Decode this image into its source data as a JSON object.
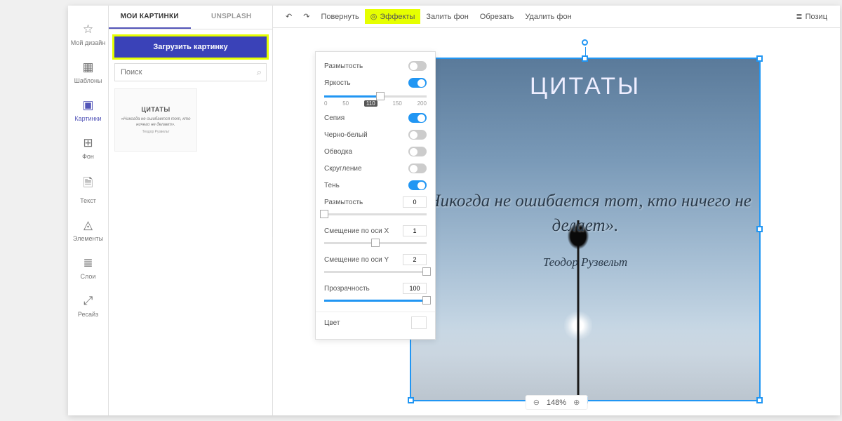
{
  "sidebar": {
    "items": [
      {
        "icon": "☆",
        "label": "Мой дизайн"
      },
      {
        "icon": "▦",
        "label": "Шаблоны"
      },
      {
        "icon": "▣",
        "label": "Картинки"
      },
      {
        "icon": "⊞",
        "label": "Фон"
      },
      {
        "icon": "🗎",
        "label": "Текст"
      },
      {
        "icon": "◬",
        "label": "Элементы"
      },
      {
        "icon": "≣",
        "label": "Слои"
      },
      {
        "icon": "⤢",
        "label": "Ресайз"
      }
    ]
  },
  "panel": {
    "tab1": "МОИ КАРТИНКИ",
    "tab2": "UNSPLASH",
    "upload": "Загрузить картинку",
    "search_ph": "Поиск",
    "thumb": {
      "title": "ЦИТАТЫ",
      "quote": "«Никогда не ошибается тот,\nкто ничего не делает».",
      "author": "Теодор Рузвельт"
    }
  },
  "toolbar": {
    "undo": "↶",
    "redo": "↷",
    "rotate": "Повернуть",
    "effects": "Эффекты",
    "fill": "Залить фон",
    "crop": "Обрезать",
    "removebg": "Удалить фон",
    "position": "Позиц"
  },
  "effects": {
    "blur": "Размытость",
    "brightness": "Яркость",
    "ticks": [
      "0",
      "50",
      "110",
      "150",
      "200"
    ],
    "sepia": "Сепия",
    "bw": "Черно-белый",
    "stroke": "Обводка",
    "round": "Скругление",
    "shadow": "Тень",
    "shadow_blur": "Размытость",
    "shadow_blur_v": "0",
    "offx": "Смещение по оси X",
    "offx_v": "1",
    "offy": "Смещение по оси Y",
    "offy_v": "2",
    "opacity": "Прозрачность",
    "opacity_v": "100",
    "color": "Цвет"
  },
  "canvas": {
    "title": "ЦИТАТЫ",
    "quote": "«Никогда не ошибается тот,\nкто ничего не делает».",
    "author": "Теодор Рузвельт"
  },
  "zoom": {
    "level": "148%"
  }
}
